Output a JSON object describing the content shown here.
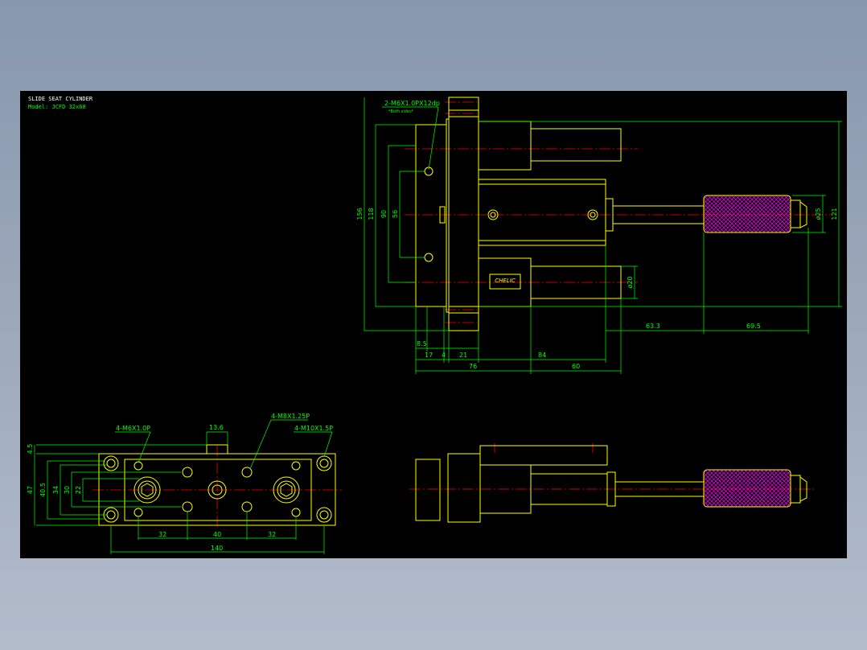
{
  "title": "SLIDE SEAT CYLINDER",
  "model": "Model: JCFD 32x60",
  "colors": {
    "background": "#000000",
    "outline": "#ffff00",
    "dimension": "#00ff00",
    "centerline": "#ff0000",
    "hatch": "#ff00ff",
    "window_top": "#8797ad",
    "window_bottom": "#b3bccb"
  },
  "brand_label": "CHELIC",
  "annotations": {
    "thread_top": "2-M6X1.0PX12dp",
    "thread_top_note": "*Both sides*",
    "m6": "4-M6X1.0P",
    "m8": "4-M8X1.25P",
    "m10": "4-M10X1.5P"
  },
  "dimensions": {
    "d156": "156",
    "d118": "118",
    "d90": "90",
    "d56": "56",
    "d8_5": "8.5",
    "d17": "17",
    "d4": "4",
    "d21": "21",
    "d84": "84",
    "d76": "76",
    "d60": "60",
    "d63_3": "63.3",
    "d69_5": "69.5",
    "phi25": "ø25",
    "d121": "121",
    "phi20": "ø20",
    "d4_5": "4.5",
    "d47": "47",
    "d40_5": "40.5",
    "d34": "34",
    "d30": "30",
    "d22": "22",
    "d13_6": "13.6",
    "b32a": "32",
    "b40": "40",
    "b32b": "32",
    "b140": "140"
  }
}
